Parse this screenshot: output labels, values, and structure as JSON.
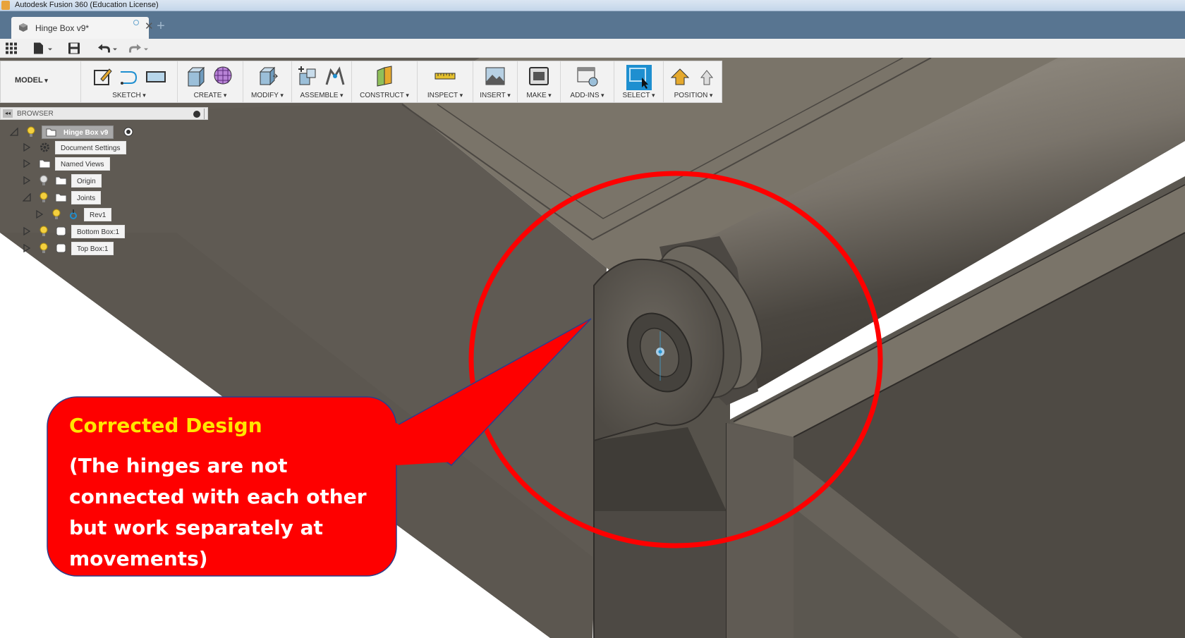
{
  "window": {
    "title": "Autodesk Fusion 360 (Education License)"
  },
  "tabs": {
    "active_label": "Hinge Box v9*",
    "close_glyph": "✕",
    "new_tab_glyph": "+"
  },
  "quick_access": {
    "icons": [
      "grid-icon",
      "file-icon",
      "save-icon",
      "undo-icon",
      "redo-icon"
    ]
  },
  "ribbon": {
    "workspace": "MODEL",
    "groups": [
      {
        "label": "SKETCH"
      },
      {
        "label": "CREATE"
      },
      {
        "label": "MODIFY"
      },
      {
        "label": "ASSEMBLE"
      },
      {
        "label": "CONSTRUCT"
      },
      {
        "label": "INSPECT"
      },
      {
        "label": "INSERT"
      },
      {
        "label": "MAKE"
      },
      {
        "label": "ADD-INS"
      },
      {
        "label": "SELECT"
      },
      {
        "label": "POSITION"
      }
    ]
  },
  "browser": {
    "title": "BROWSER",
    "nodes": [
      {
        "label": "Hinge Box v9",
        "expanded": true,
        "selected": true
      },
      {
        "label": "Document Settings",
        "expanded": false
      },
      {
        "label": "Named Views",
        "expanded": false
      },
      {
        "label": "Origin",
        "expanded": false
      },
      {
        "label": "Joints",
        "expanded": true
      },
      {
        "label": "Rev1",
        "expanded": false
      },
      {
        "label": "Bottom Box:1",
        "expanded": false
      },
      {
        "label": "Top Box:1",
        "expanded": false
      }
    ]
  },
  "callout": {
    "title": "Corrected Design",
    "body": "(The hinges are not connected with each other but work separately at movements)",
    "bubble_color": "#fe0000",
    "title_color": "#ffe600",
    "ring_color": "#ff0000"
  },
  "colors": {
    "tabbar": "#587591",
    "model_dark": "#5f5a53",
    "model_light": "#7b756c",
    "selection_blue": "#1e8fd0"
  }
}
